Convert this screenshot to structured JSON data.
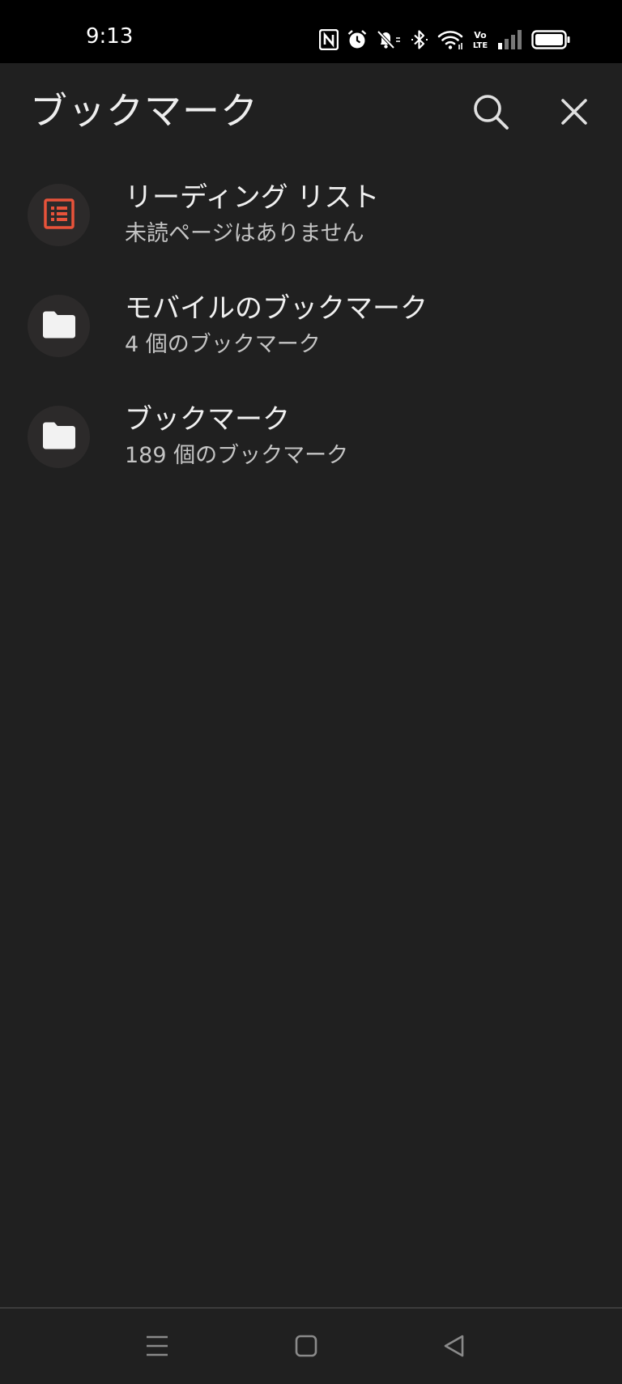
{
  "status_bar": {
    "time": "9:13",
    "icons": [
      "nfc-icon",
      "alarm-icon",
      "mute-icon",
      "bluetooth-icon",
      "wifi-icon",
      "volte-icon",
      "signal-icon",
      "battery-icon"
    ],
    "volte_label_top": "Vo",
    "volte_label_bottom": "LTE"
  },
  "app_bar": {
    "title": "ブックマーク",
    "search_icon": "search-icon",
    "close_icon": "close-icon"
  },
  "bookmarks": [
    {
      "title": "リーディング リスト",
      "subtitle": "未読ページはありません",
      "icon": "reading-list-icon"
    },
    {
      "title": "モバイルのブックマーク",
      "subtitle": "4 個のブックマーク",
      "icon": "folder-icon"
    },
    {
      "title": "ブックマーク",
      "subtitle": "189 個のブックマーク",
      "icon": "folder-icon"
    }
  ],
  "nav_bar": {
    "icons": [
      "menu-icon",
      "home-icon",
      "back-icon"
    ]
  },
  "colors": {
    "background": "#202020",
    "status_bar": "#000000",
    "accent_red": "#e8533a",
    "text_primary": "#f0f0f0",
    "text_secondary": "#c4c4c4",
    "avatar_bg": "#2c2a2a"
  }
}
